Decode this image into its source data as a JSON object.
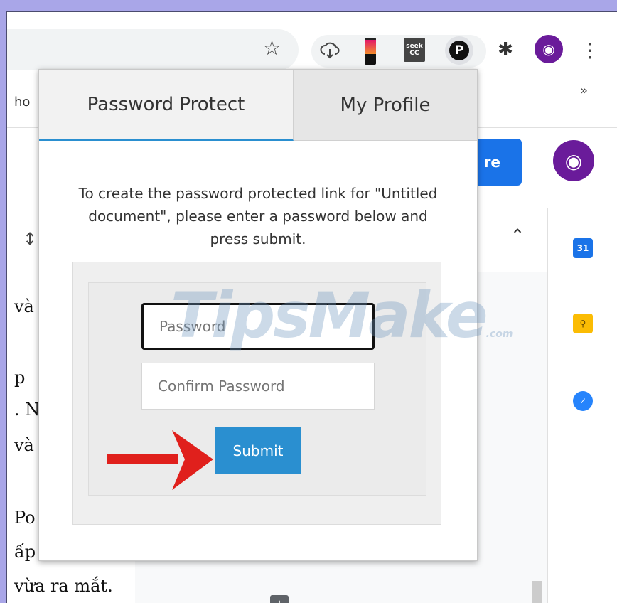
{
  "browser": {
    "bookmark_fragment": "ho",
    "bookmarks_more": "»",
    "extensions": {
      "seek_line1": "seek",
      "seek_line2": "CC",
      "p_badge": "P"
    }
  },
  "docs": {
    "share_label": "re",
    "calendar_day": "31",
    "text_lines": [
      "và",
      "p",
      ". N",
      "và",
      "Po",
      "ấp",
      "vừa ra mắt."
    ]
  },
  "popup": {
    "tabs": [
      {
        "label": "Password Protect",
        "active": true
      },
      {
        "label": "My Profile",
        "active": false
      }
    ],
    "instructions": "To create the password protected link for \"Untitled document\", please enter a password below and press submit.",
    "password_placeholder": "Password",
    "confirm_placeholder": "Confirm Password",
    "submit_label": "Submit"
  },
  "watermark": {
    "text": "TipsMake",
    "suffix": ".com"
  },
  "colors": {
    "accent": "#2a8fd0",
    "share_blue": "#1a73e8",
    "arrow_red": "#e0201c",
    "frame": "#a9a6e8"
  }
}
